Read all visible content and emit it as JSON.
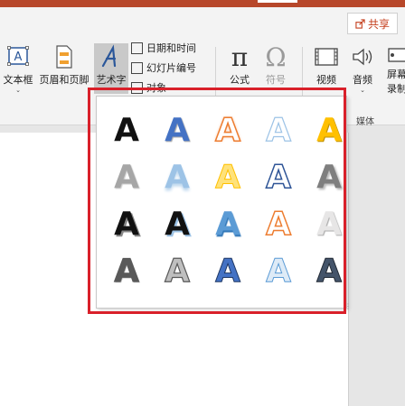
{
  "ribbon": {
    "share_label": "共享",
    "textbox_label": "文本框",
    "header_footer_label": "页眉和页脚",
    "wordart_label": "艺术字",
    "datetime_label": "日期和时间",
    "slide_number_label": "幻灯片编号",
    "object_label": "对象",
    "equation_label": "公式",
    "equation_icon": "π",
    "symbol_label": "符号",
    "symbol_icon": "Ω",
    "video_label": "视频",
    "audio_label": "音频",
    "screen_rec_label_1": "屏幕",
    "screen_rec_label_2": "录制",
    "media_group_label": "媒体"
  },
  "gallery": {
    "glyph": "A",
    "item_count": 20,
    "columns": 5,
    "rows": 4
  },
  "colors": {
    "accent_red": "#d9202a",
    "title_bar": "#b7472a",
    "selected_button": "#c9c9c9"
  }
}
